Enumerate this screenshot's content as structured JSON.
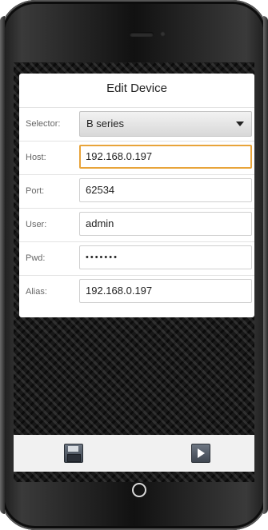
{
  "dialog": {
    "title": "Edit Device"
  },
  "form": {
    "selector": {
      "label": "Selector:",
      "value": "B series"
    },
    "host": {
      "label": "Host:",
      "value": "192.168.0.197"
    },
    "port": {
      "label": "Port:",
      "value": "62534"
    },
    "user": {
      "label": "User:",
      "value": "admin"
    },
    "pwd": {
      "label": "Pwd:",
      "value": "•••••••"
    },
    "alias": {
      "label": "Alias:",
      "value": "192.168.0.197"
    }
  },
  "toolbar": {
    "save_icon": "save-icon",
    "play_icon": "play-icon"
  },
  "colors": {
    "focus_border": "#e8a43a",
    "screen_background": "#181818",
    "toolbar_background": "#f1f1f1"
  }
}
